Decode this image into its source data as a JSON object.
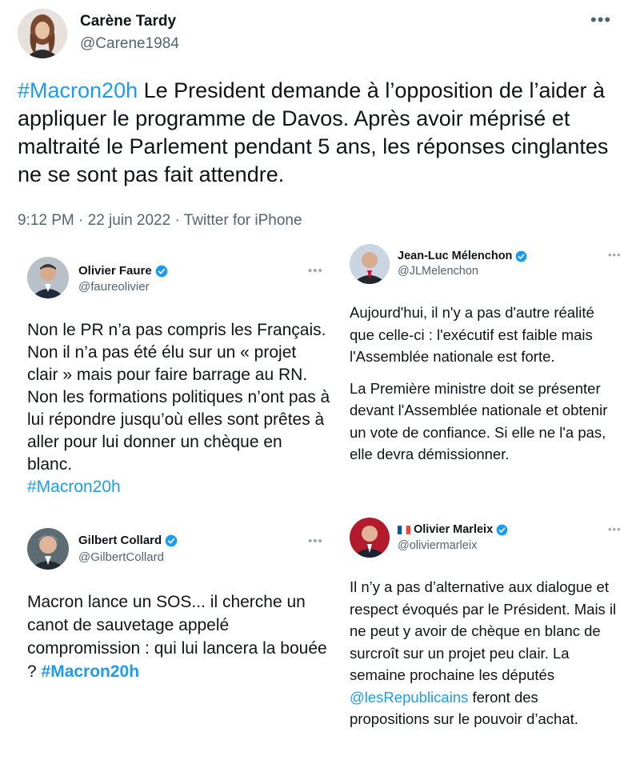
{
  "main": {
    "author_name": "Carène Tardy",
    "author_handle": "@Carene1984",
    "hashtag": "#Macron20h",
    "text": " Le President demande à l’opposition de l’aider à appliquer le programme de Davos. Après avoir méprisé et maltraité le Parlement pendant 5 ans, les réponses cinglantes ne se sont pas fait attendre.",
    "timestamp": "9:12 PM · 22 juin 2022 · Twitter for iPhone",
    "more_icon": "more-dots-icon"
  },
  "faure": {
    "name": "Olivier Faure",
    "handle": "@faureolivier",
    "text": "Non le PR n’a pas compris les Français. Non il n’a pas été élu sur un « projet clair » mais pour faire barrage au RN. Non les formations politiques n’ont pas à lui répondre jusqu’où elles sont prêtes à aller pour lui donner un chèque en blanc.",
    "hashtag": "#Macron20h"
  },
  "melenchon": {
    "name": "Jean-Luc Mélenchon",
    "handle": "@JLMelenchon",
    "text1": "Aujourd'hui, il n'y a pas d'autre réalité que celle-ci : l'exécutif est faible mais l'Assemblée nationale est forte.",
    "text2": "La Première ministre doit se présenter devant l'Assemblée nationale et obtenir un vote de confiance. Si elle ne l'a pas, elle devra démissionner."
  },
  "collard": {
    "name": "Gilbert Collard",
    "handle": "@GilbertCollard",
    "text": "Macron lance un SOS... il cherche un canot de sauvetage appelé compromission : qui lui lancera la bouée ? ",
    "hashtag": "#Macron20h"
  },
  "marleix": {
    "flag": "🇫🇷",
    "name": "Olivier Marleix",
    "handle": "@oliviermarleix",
    "text_before": "Il n’y a pas d’alternative aux dialogue et respect évoqués par le Président. Mais il ne peut y avoir de chèque en blanc de surcroît sur un projet peu clair. La semaine prochaine les députés ",
    "mention": "@lesRepublicains",
    "text_after": " feront des propositions sur le pouvoir d’achat."
  },
  "colors": {
    "accent": "#1d9bf0",
    "text": "#0f1419",
    "muted": "#536471"
  }
}
